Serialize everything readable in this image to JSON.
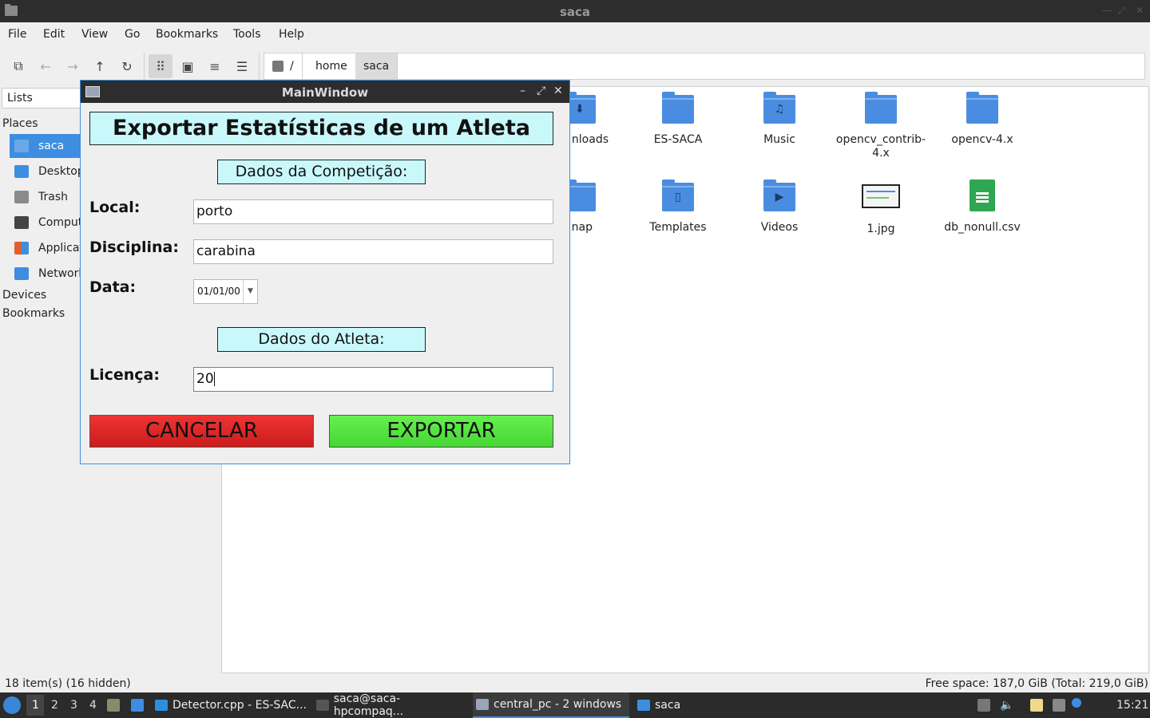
{
  "window": {
    "title": "saca"
  },
  "menu": [
    "File",
    "Edit",
    "View",
    "Go",
    "Bookmarks",
    "Tools",
    "Help"
  ],
  "path": {
    "root": "/",
    "crumbs": [
      "home",
      "saca"
    ]
  },
  "sidebar": {
    "select": "Lists",
    "places_label": "Places",
    "items": [
      {
        "label": "saca",
        "icon": "home-folder-icon",
        "color": "#3d8ee0"
      },
      {
        "label": "Desktop",
        "icon": "desktop-icon",
        "color": "#3d8ee0"
      },
      {
        "label": "Trash",
        "icon": "trash-icon",
        "color": "#8a8a8a"
      },
      {
        "label": "Computer",
        "icon": "computer-icon",
        "color": "#444444"
      },
      {
        "label": "Applications",
        "icon": "applications-icon",
        "color": "#e06030"
      },
      {
        "label": "Network",
        "icon": "network-icon",
        "color": "#3d8ee0"
      }
    ],
    "devices_label": "Devices",
    "bookmarks_label": "Bookmarks"
  },
  "files": [
    {
      "name": "Downloads",
      "visible_label": "nloads",
      "type": "folder",
      "glyph": "⬇"
    },
    {
      "name": "ES-SACA",
      "visible_label": "ES-SACA",
      "type": "folder",
      "glyph": ""
    },
    {
      "name": "Music",
      "visible_label": "Music",
      "type": "folder",
      "glyph": "♫"
    },
    {
      "name": "opencv_contrib-4.x",
      "visible_label": "opencv_contrib-\n4.x",
      "type": "folder",
      "glyph": ""
    },
    {
      "name": "opencv-4.x",
      "visible_label": "opencv-4.x",
      "type": "folder",
      "glyph": ""
    },
    {
      "name": "snap",
      "visible_label": "nap",
      "type": "folder",
      "glyph": ""
    },
    {
      "name": "Templates",
      "visible_label": "Templates",
      "type": "folder",
      "glyph": "▯"
    },
    {
      "name": "Videos",
      "visible_label": "Videos",
      "type": "folder",
      "glyph": "▶"
    },
    {
      "name": "1.jpg",
      "visible_label": "1.jpg",
      "type": "image"
    },
    {
      "name": "db_nonull.csv",
      "visible_label": "db_nonull.csv",
      "type": "spreadsheet"
    }
  ],
  "status": {
    "left": "18 item(s) (16 hidden)",
    "right": "Free space: 187,0 GiB (Total: 219,0 GiB)"
  },
  "dialog": {
    "title": "MainWindow",
    "heading": "Exportar Estatísticas de um Atleta",
    "section_competition": "Dados da Competição:",
    "local_label": "Local:",
    "local_value": "porto",
    "discipline_label": "Disciplina:",
    "discipline_value": "carabina",
    "date_label": "Data:",
    "date_value": "01/01/00",
    "section_athlete": "Dados do Atleta:",
    "license_label": "Licença:",
    "license_value": "20",
    "cancel": "CANCELAR",
    "export": "EXPORTAR"
  },
  "taskbar": {
    "workspaces": [
      "1",
      "2",
      "3",
      "4"
    ],
    "tasks": [
      {
        "label": "Detector.cpp - ES-SAC...",
        "color": "#2b8fe0"
      },
      {
        "label": "saca@saca-hpcompaq...",
        "color": "#555555"
      },
      {
        "label": "central_pc - 2 windows",
        "color": "#9aa6b8"
      },
      {
        "label": "saca",
        "color": "#3d8ee0"
      }
    ],
    "clock": "15:21"
  }
}
